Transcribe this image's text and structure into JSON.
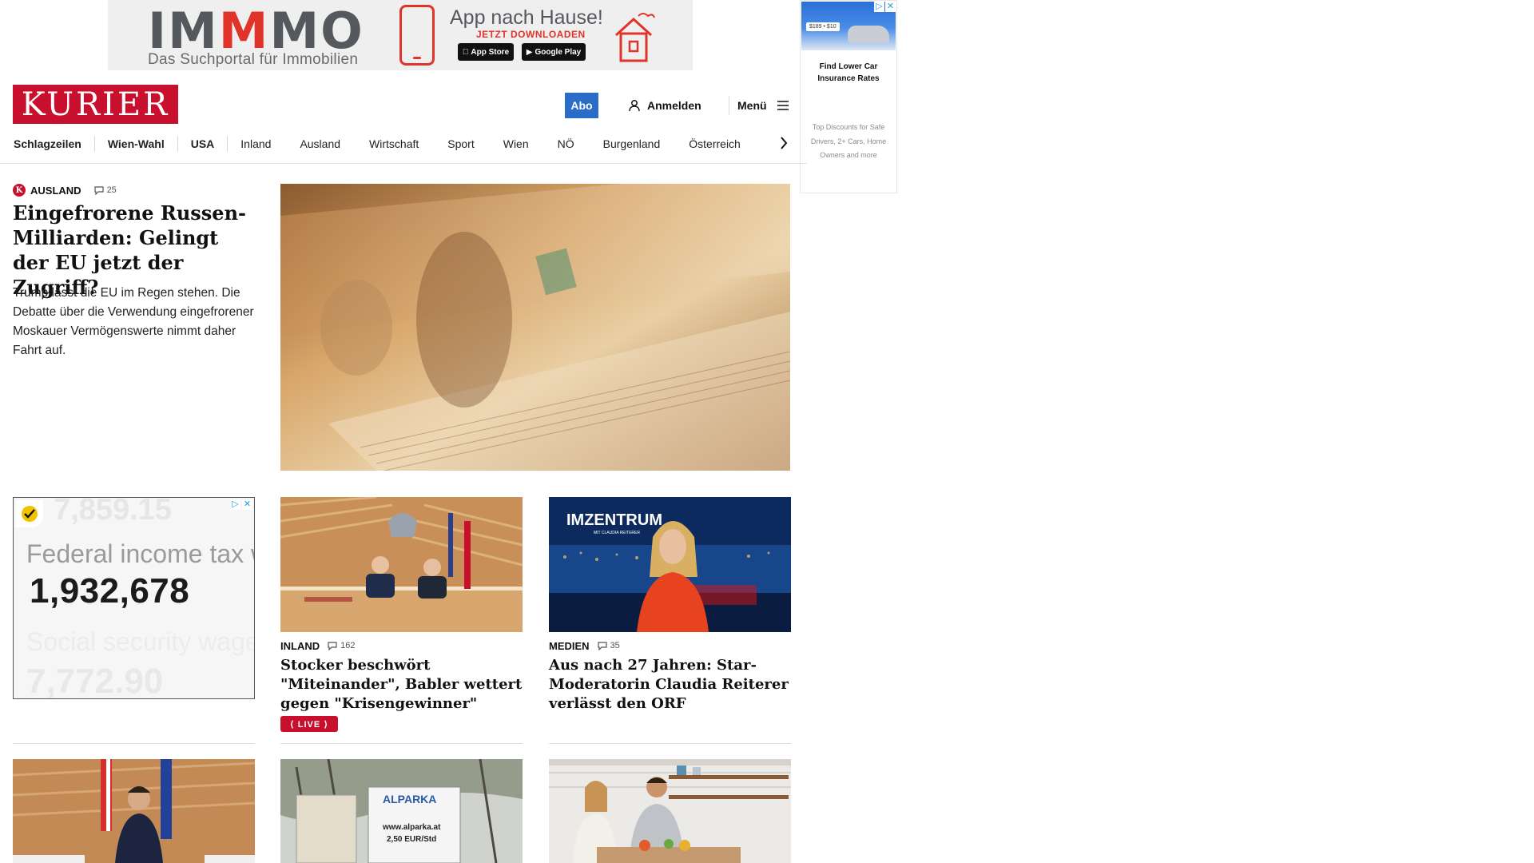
{
  "top_ad": {
    "logo_part1": "IM",
    "logo_part2": "M",
    "logo_part3": "MO",
    "tagline": "Das Suchportal für Immobilien",
    "app_title": "App nach Hause!",
    "cta": "JETZT DOWNLOADEN",
    "app_store": "App Store",
    "google_play": "Google Play",
    "brand_color": "#e0332a"
  },
  "side_ad": {
    "price_a": "$189",
    "price_b": "$10",
    "headline": "Find Lower Car Insurance Rates",
    "body": "Top Discounts for Safe Drivers, 2+ Cars, Home Owners and more"
  },
  "header": {
    "logo": "KURIER",
    "abo": "Abo",
    "login": "Anmelden",
    "menu": "Menü",
    "brand_color": "#c8102e",
    "abo_color": "#2a6dc9"
  },
  "nav": {
    "items": [
      "Schlagzeilen",
      "Wien-Wahl",
      "USA",
      "Inland",
      "Ausland",
      "Wirtschaft",
      "Sport",
      "Wien",
      "NÖ",
      "Burgenland",
      "Österreich"
    ]
  },
  "lead": {
    "section": "AUSLAND",
    "comments": "25",
    "title": "Eingefrorene Russen-Milliarden: Gelingt der EU jetzt der Zugriff?",
    "teaser": "Trump lässt die EU im Regen stehen. Die Debatte über die Verwendung eingefrorener Moskauer Vermögenswerte nimmt daher Fahrt auf."
  },
  "mid_ad": {
    "label1": "Federal income tax w",
    "value1": "1,932,678",
    "label2": "Social security wage",
    "value2": "7,772.90",
    "ghost": "7,859.15"
  },
  "cards": [
    {
      "section": "INLAND",
      "comments": "162",
      "title": "Stocker beschwört \"Miteinander\", Babler wettert gegen \"Krisengewinner\"",
      "live": "⟨ LIVE ⟩"
    },
    {
      "section": "MEDIEN",
      "comments": "35",
      "title": "Aus nach 27 Jahren: Star-Moderatorin Claudia Reiterer verlässt den ORF",
      "image_text": "IMZENTRUM",
      "image_subtext": "MIT CLAUDIA REITERER"
    }
  ],
  "bottom_images": {
    "sign_brand": "ALPARKA",
    "sign_url": "www.alparka.at",
    "sign_price": "2,50 EUR/Std"
  }
}
